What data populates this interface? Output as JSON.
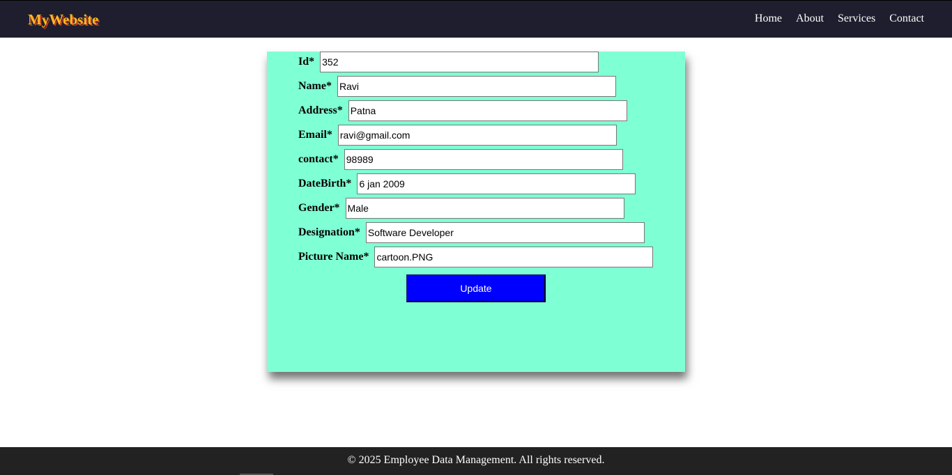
{
  "nav": {
    "brand": "MyWebsite",
    "links": [
      "Home",
      "About",
      "Services",
      "Contact"
    ]
  },
  "form": {
    "fields": [
      {
        "label": "Id*",
        "value": "352"
      },
      {
        "label": "Name*",
        "value": "Ravi"
      },
      {
        "label": "Address*",
        "value": "Patna"
      },
      {
        "label": "Email*",
        "value": "ravi@gmail.com"
      },
      {
        "label": "contact*",
        "value": "98989"
      },
      {
        "label": "DateBirth*",
        "value": "6 jan 2009"
      },
      {
        "label": "Gender*",
        "value": "Male"
      },
      {
        "label": "Designation*",
        "value": "Software Developer"
      },
      {
        "label": "Picture Name*",
        "value": "cartoon.PNG"
      }
    ],
    "submit_label": "Update"
  },
  "footer": {
    "text": "© 2025 Employee Data Management. All rights reserved."
  },
  "colors": {
    "navbar": "#1f1e2e",
    "brand": "#ffb81f",
    "form_background": "#7fffd4",
    "button": "#0000ff",
    "footer": "#222222"
  }
}
